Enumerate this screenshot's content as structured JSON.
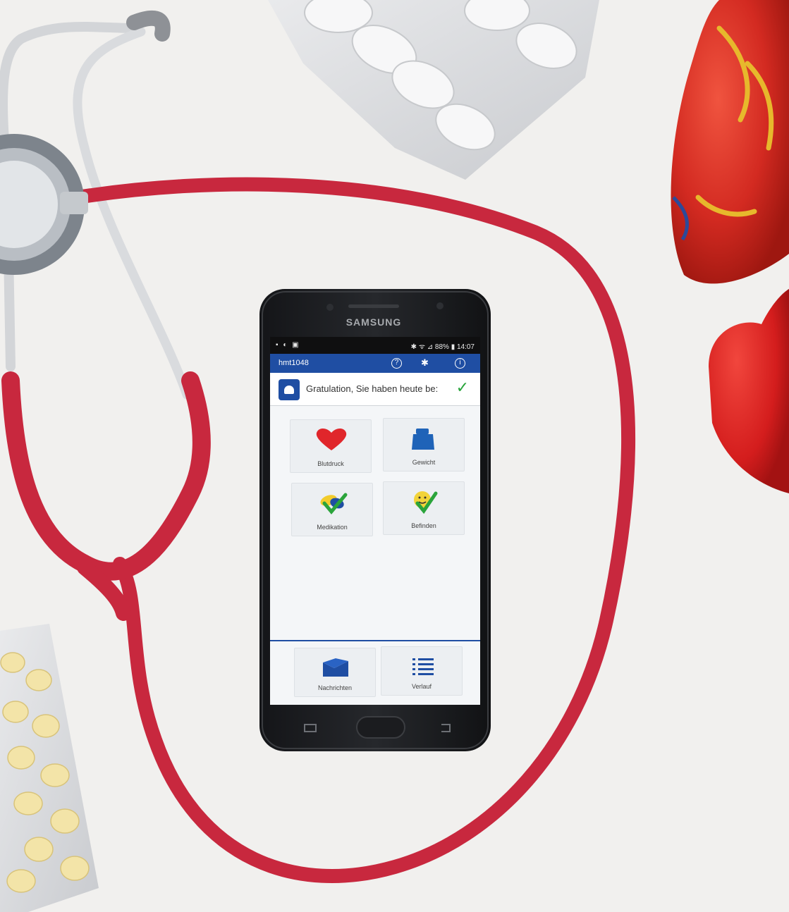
{
  "phone": {
    "brand": "SAMSUNG",
    "status_left": "▪ ◐ ▣",
    "status_right": "✱ ᯤ ⊿ 88% ▮ 14:07"
  },
  "app": {
    "title": "hmt1048",
    "help_icon": "help-circle-icon",
    "bluetooth_icon": "bluetooth-icon",
    "info_icon": "info-icon",
    "banner_text": "Gratulation, Sie haben heute be:",
    "tiles": [
      {
        "label": "Blutdruck",
        "icon": "heart-icon"
      },
      {
        "label": "Gewicht",
        "icon": "scale-icon"
      },
      {
        "label": "Medikation",
        "icon": "medication-check-icon"
      },
      {
        "label": "Befinden",
        "icon": "smiley-check-icon"
      }
    ],
    "bottom_tiles": [
      {
        "label": "Nachrichten",
        "icon": "envelope-icon"
      },
      {
        "label": "Verlauf",
        "icon": "list-icon"
      }
    ]
  },
  "colors": {
    "app_blue": "#1f4ea3",
    "stethoscope_red": "#c8283e",
    "check_green": "#27a43a"
  }
}
